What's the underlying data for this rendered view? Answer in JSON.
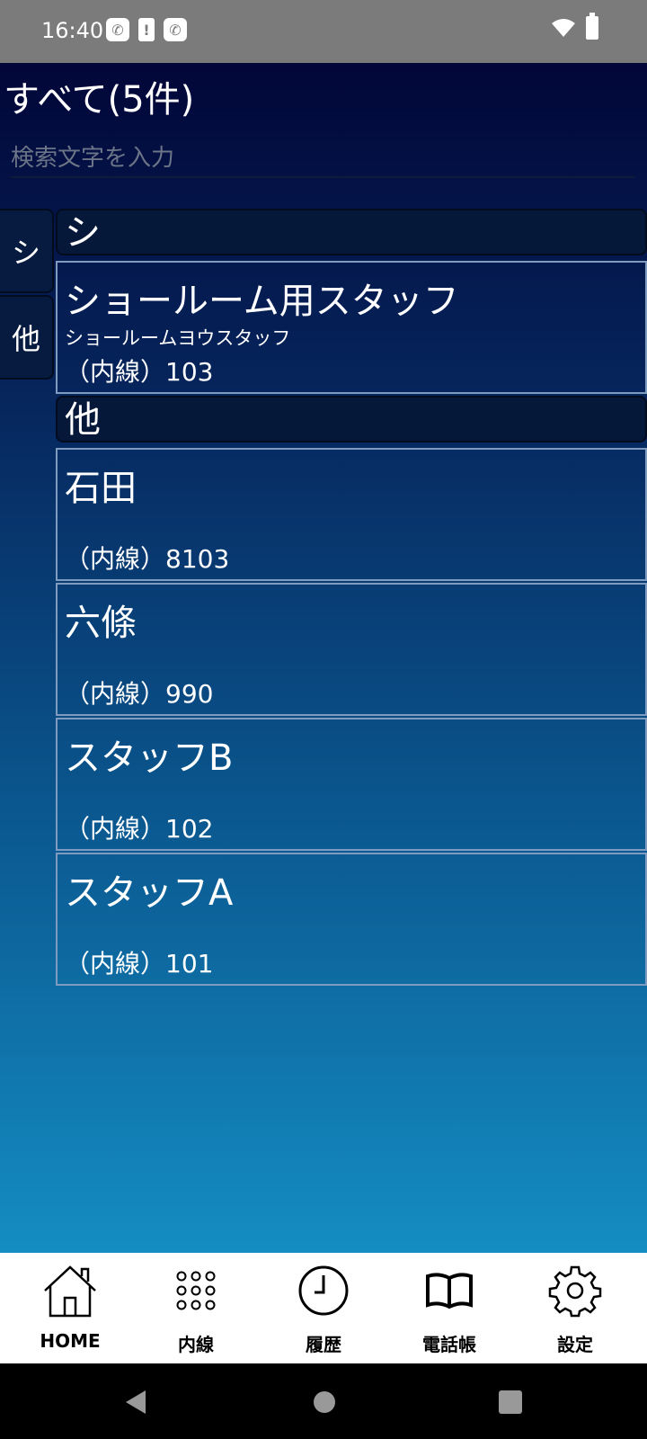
{
  "status": {
    "time": "16:40"
  },
  "header": {
    "title": "すべて(5件)"
  },
  "search": {
    "placeholder": "検索文字を入力"
  },
  "index_tabs": [
    "シ",
    "他"
  ],
  "sections": [
    {
      "header": "シ",
      "contacts": [
        {
          "name": "ショールーム用スタッフ",
          "kana": "ショールームヨウスタッフ",
          "ext": "（内線）103"
        }
      ]
    },
    {
      "header": "他",
      "contacts": [
        {
          "name": "石田",
          "kana": "",
          "ext": "（内線）8103"
        },
        {
          "name": "六條",
          "kana": "",
          "ext": "（内線）990"
        },
        {
          "name": "スタッフB",
          "kana": "",
          "ext": "（内線）102"
        },
        {
          "name": "スタッフA",
          "kana": "",
          "ext": "（内線）101"
        }
      ]
    }
  ],
  "nav": [
    {
      "label": "HOME",
      "icon": "home-icon"
    },
    {
      "label": "内線",
      "icon": "dialpad-icon"
    },
    {
      "label": "履歴",
      "icon": "clock-icon"
    },
    {
      "label": "電話帳",
      "icon": "book-icon"
    },
    {
      "label": "設定",
      "icon": "gear-icon"
    }
  ],
  "colors": {
    "gradient_top": "#020638",
    "gradient_bottom": "#148dc2",
    "section_header": "#06183a",
    "status_bar": "#7b7b7b"
  }
}
